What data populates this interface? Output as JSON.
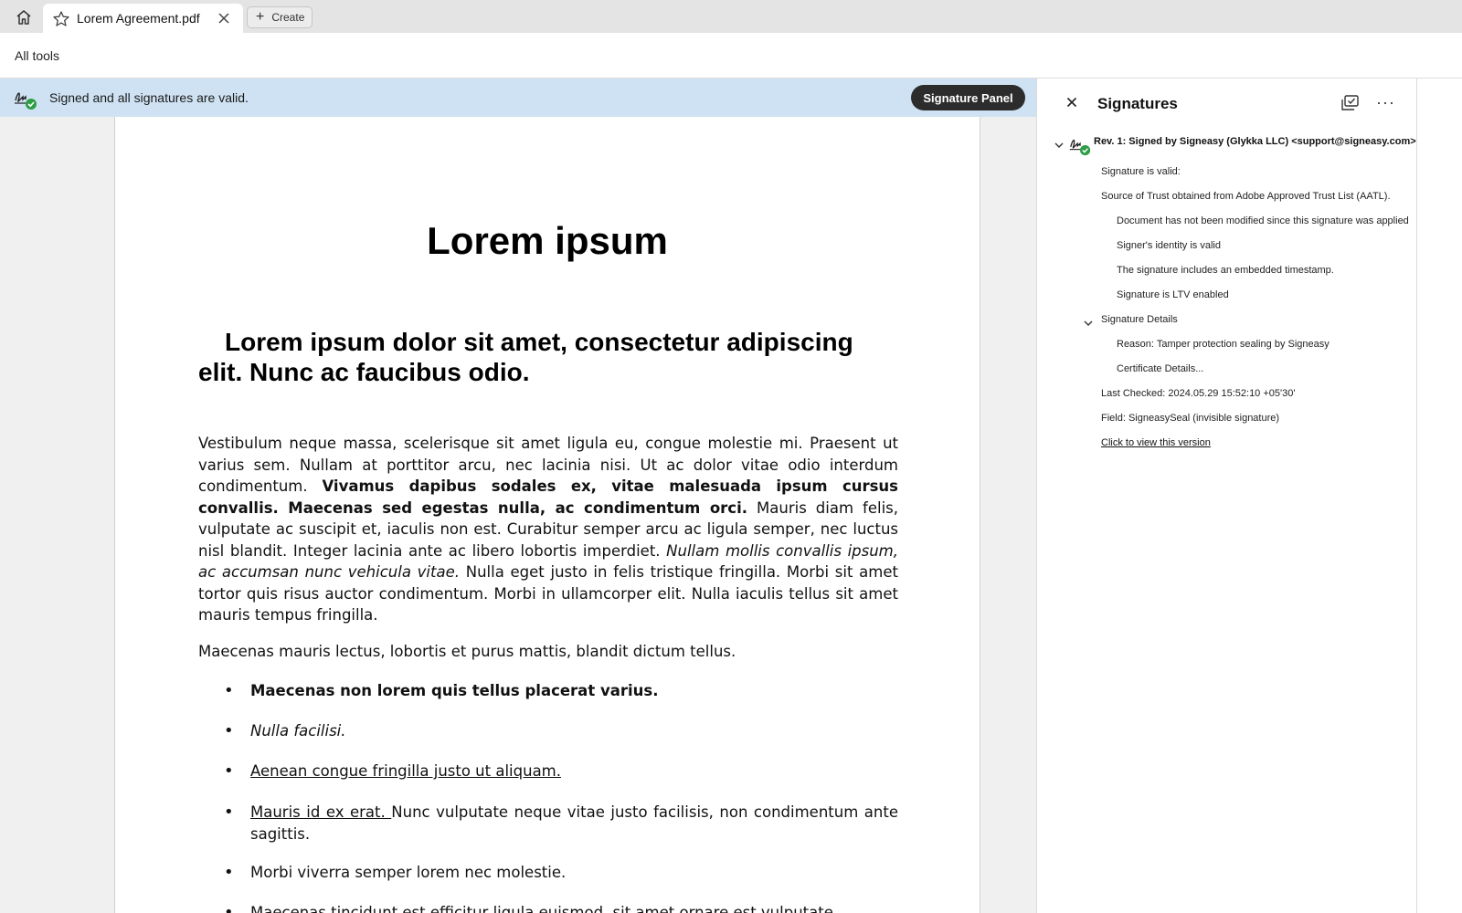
{
  "tabs": {
    "home_icon": "home-icon",
    "active_tab": {
      "title": "Lorem Agreement.pdf",
      "star_icon": "star-icon",
      "close_icon": "close-icon"
    },
    "create_label": "Create"
  },
  "toolbar": {
    "all_tools_label": "All tools"
  },
  "banner": {
    "text": "Signed and all signatures are valid.",
    "button_label": "Signature Panel",
    "bg_color": "#cfe2f3"
  },
  "document": {
    "title": "Lorem ipsum",
    "subtitle": "Lorem ipsum dolor sit amet, consectetur adipiscing elit. Nunc ac faucibus odio.",
    "paragraph1": {
      "part1": "Vestibulum neque massa, scelerisque sit amet ligula eu, congue molestie mi. Praesent ut varius sem. Nullam at porttitor arcu, nec lacinia nisi. Ut ac dolor vitae odio interdum condimentum. ",
      "bold": "Vivamus dapibus sodales ex, vitae malesuada ipsum cursus convallis. Maecenas sed egestas nulla, ac condimentum orci.",
      "part2": " Mauris diam felis, vulputate ac suscipit et, iaculis non est. Curabitur semper arcu ac ligula semper, nec luctus nisl blandit. Integer lacinia ante ac libero lobortis imperdiet. ",
      "italic": "Nullam mollis convallis ipsum, ac accumsan nunc vehicula vitae.",
      "part3": " Nulla eget justo in felis tristique fringilla. Morbi sit amet tortor quis risus auctor condimentum. Morbi in ullamcorper elit. Nulla iaculis tellus sit amet mauris tempus fringilla."
    },
    "paragraph2": "Maecenas mauris lectus, lobortis et purus mattis, blandit dictum tellus.",
    "bullets": {
      "b1": "Maecenas non lorem quis tellus placerat varius.",
      "b2": "Nulla facilisi.",
      "b3": "Aenean congue fringilla justo ut aliquam. ",
      "b4_underlined": "Mauris id ex erat. ",
      "b4_rest": "Nunc vulputate neque vitae justo facilisis, non condimentum ante sagittis.",
      "b5": "Morbi viverra semper lorem nec molestie.",
      "b6": "Maecenas tincidunt est efficitur ligula euismod, sit amet ornare est vulputate."
    }
  },
  "panel": {
    "title": "Signatures",
    "close_icon": "close-icon",
    "popout_icon": "popout-icon",
    "more_icon": "more-options-icon",
    "revision": "Rev. 1: Signed by Signeasy (Glykka LLC) <support@signeasy.com>",
    "valid_label": "Signature is valid:",
    "source": "Source of Trust obtained from Adobe Approved Trust List (AATL).",
    "checks": [
      "Document has not been modified since this signature was applied",
      "Signer's identity is valid",
      "The signature includes an embedded timestamp.",
      "Signature is LTV enabled"
    ],
    "details_label": "Signature Details",
    "reason": "Reason: Tamper protection sealing by Signeasy",
    "certificate": "Certificate Details...",
    "last_checked": "Last Checked: 2024.05.29 15:52:10 +05'30'",
    "field": "Field: SigneasySeal (invisible signature)",
    "view_version": "Click to view this version",
    "valid_color": "#2d9d46"
  }
}
